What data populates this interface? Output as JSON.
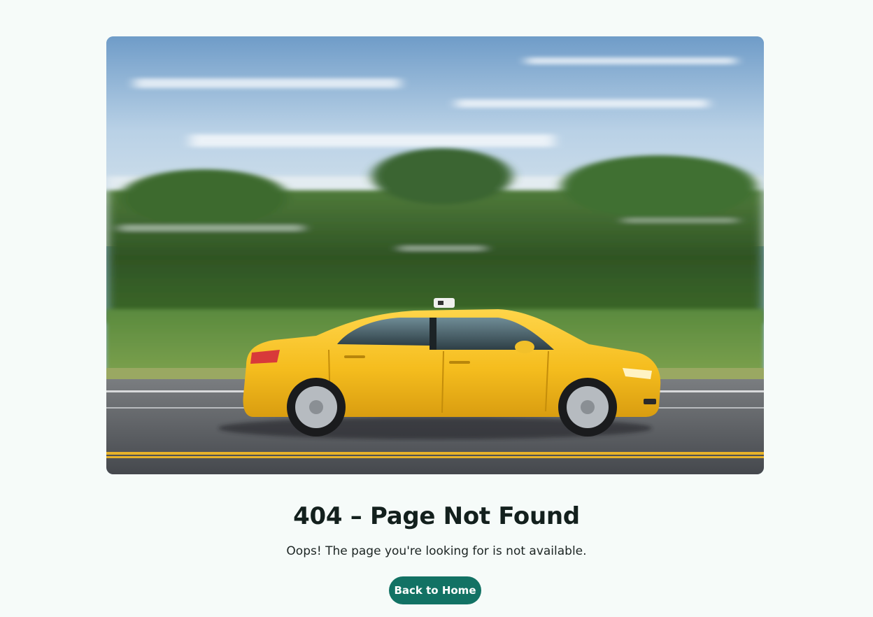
{
  "hero": {
    "image_label": "yellow-taxi-motion-blur",
    "colors": {
      "sky": "#9dbfdc",
      "trees": "#3f6a2c",
      "road": "#5c5f63",
      "taxi": "#f5c12a",
      "lane_line": "#e6b22a"
    }
  },
  "error": {
    "title": "404 – Page Not Found",
    "message": "Oops! The page you're looking for is not available."
  },
  "actions": {
    "home_label": "Back to Home"
  },
  "theme": {
    "page_background": "#f6fbf9",
    "button_color": "#127264"
  }
}
